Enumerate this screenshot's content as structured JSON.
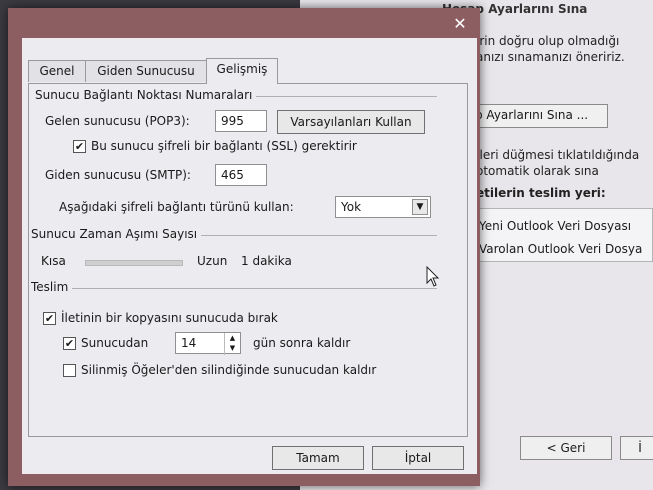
{
  "background": {
    "title": "Hesap Ayarlarını Sına",
    "lines": [
      "irin doğru olup olmadığı",
      "anızı sınamanızı öneririz."
    ],
    "test_button": "p Ayarlarını Sına ...",
    "info_lines": [
      "İleri düğmesi tıklatıldığında",
      "otomatik olarak sına"
    ],
    "delivery_label": "etilerin teslim yeri:",
    "delivery_options": [
      "Yeni Outlook Veri Dosyası",
      "Varolan Outlook Veri Dosya"
    ],
    "back_button": "< Geri",
    "next_button": "İ"
  },
  "dialog": {
    "close": "✕",
    "tabs": [
      "Genel",
      "Giden Sunucusu",
      "Gelişmiş"
    ],
    "active_tab": 2,
    "port_group": "Sunucu Bağlantı Noktası Numaraları",
    "incoming_label": "Gelen sunucusu (POP3):",
    "incoming_value": "995",
    "defaults_button": "Varsayılanları Kullan",
    "ssl_label": "Bu sunucu şifreli bir bağlantı (SSL) gerektirir",
    "ssl_checked": true,
    "outgoing_label": "Giden sunucusu (SMTP):",
    "outgoing_value": "465",
    "encryption_label": "Aşağıdaki şifreli bağlantı türünü kullan:",
    "encryption_value": "Yok",
    "timeout_group": "Sunucu Zaman Aşımı Sayısı",
    "timeout_short": "Kısa",
    "timeout_long": "Uzun",
    "timeout_value": "1 dakika",
    "timeout_level": 0.1,
    "delivery_group": "Teslim",
    "leave_copy_label": "İletinin bir kopyasını sunucuda bırak",
    "leave_copy_checked": true,
    "remove_label_prefix": "Sunucudan",
    "remove_days": "14",
    "remove_label_suffix": "gün sonra kaldır",
    "remove_checked": true,
    "deleted_label": "Silinmiş Öğeler'den silindiğinde sunucudan kaldır",
    "deleted_checked": false,
    "ok_button": "Tamam",
    "cancel_button": "İptal"
  }
}
